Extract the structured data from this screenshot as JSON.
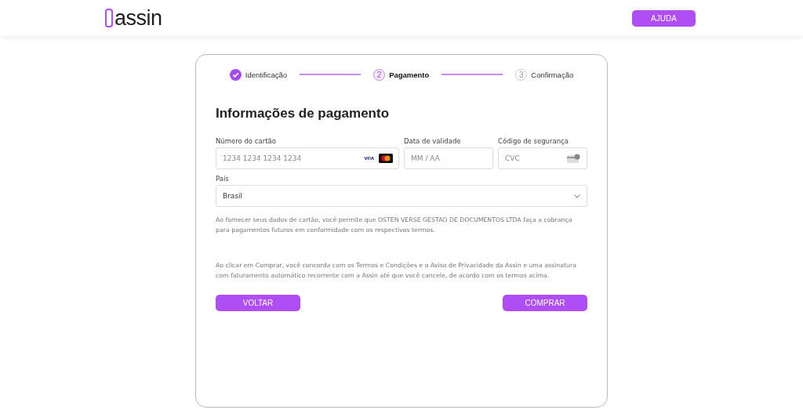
{
  "header": {
    "logo": "assin",
    "help_button": "AJUDA"
  },
  "steps": [
    {
      "label": "Identificação",
      "done": true,
      "selected": false
    },
    {
      "number": "2",
      "label": "Pagamento",
      "done": false,
      "selected": true
    },
    {
      "number": "3",
      "label": "Confirmação",
      "done": false,
      "selected": false
    }
  ],
  "title": "Informações de pagamento",
  "fields": [
    {
      "label": "Número do cartão",
      "placeholder": "1234 1234 1234 1234",
      "kind": "card"
    },
    {
      "label": "Data de validade",
      "placeholder": "MM / AA",
      "kind": "plain"
    },
    {
      "label": "Código de segurança",
      "placeholder": "CVC",
      "kind": "cvc"
    }
  ],
  "country": {
    "label": "País",
    "value": "Brasil"
  },
  "notices": [
    "Ao fornecer seus dados de cartão, você permite que OSTEN VERSE GESTAO DE DOCUMENTOS LTDA faça a cobrança para pagamentos futuros em conformidade com os respectivos termos.",
    "Ao clicar em Comprar, você concorda com os Termos e Condições e o Aviso de Privacidade da Assin e uma assinatura com faturamento automático recorrente com a Assin até que você cancele, de acordo com os termos acima."
  ],
  "buttons": {
    "back": "VOLTAR",
    "buy": "COMPRAR"
  }
}
